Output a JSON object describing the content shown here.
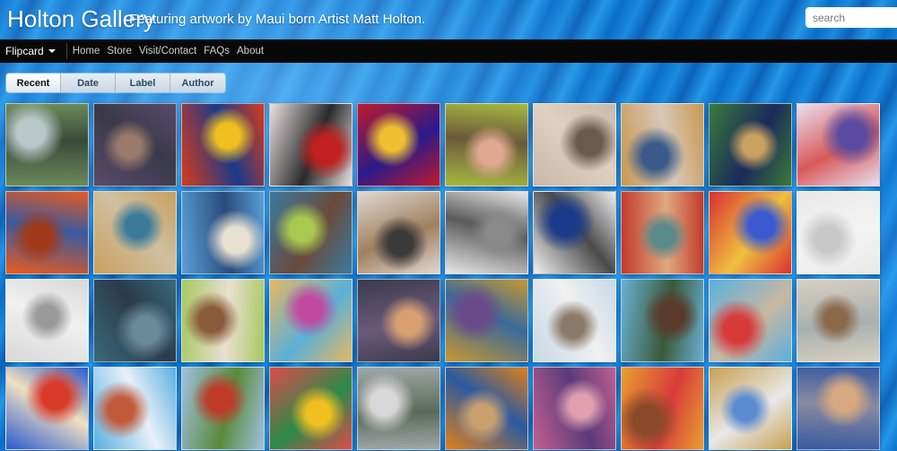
{
  "header": {
    "title": "Holton Gallery",
    "tagline": "Featuring artwork by Maui born Artist Matt Holton.",
    "search_placeholder": "search"
  },
  "navbar": {
    "brand": "Flipcard",
    "items": [
      "Home",
      "Store",
      "Visit/Contact",
      "FAQs",
      "About"
    ]
  },
  "sort_tabs": [
    "Recent",
    "Date",
    "Label",
    "Author"
  ],
  "active_tab": "Recent",
  "gallery": {
    "thumbnails": [
      {
        "name": "horses-river-painting",
        "colors": [
          "#6a8a5a",
          "#b8c8c8",
          "#3a4a3a"
        ]
      },
      {
        "name": "woman-guitar-painting",
        "colors": [
          "#5a4a6a",
          "#9a7a6a",
          "#3a3a4a"
        ]
      },
      {
        "name": "tiki-mask-painting",
        "colors": [
          "#d83a1a",
          "#f0c020",
          "#1a3a8a"
        ]
      },
      {
        "name": "red-stencil-art",
        "colors": [
          "#e8e0e0",
          "#c02020",
          "#2a2a2a"
        ]
      },
      {
        "name": "red-mandala-quilt",
        "colors": [
          "#c01a2a",
          "#f0c030",
          "#2a1a8a"
        ]
      },
      {
        "name": "reclining-figure-painting",
        "colors": [
          "#a8b840",
          "#e0a890",
          "#6a5a3a"
        ]
      },
      {
        "name": "woman-flower-hair",
        "colors": [
          "#c8b8a8",
          "#6a5a4a",
          "#e0d0c0"
        ]
      },
      {
        "name": "framed-athlete-portrait",
        "colors": [
          "#c89850",
          "#3a5a8a",
          "#d8c8b8"
        ]
      },
      {
        "name": "female-athlete-portrait",
        "colors": [
          "#3a7a3a",
          "#c8a060",
          "#1a2a5a"
        ]
      },
      {
        "name": "runner-blue-border",
        "colors": [
          "#e8e0f0",
          "#5a4aa0",
          "#d85a5a"
        ]
      },
      {
        "name": "abstract-bottle",
        "colors": [
          "#e85a20",
          "#a03a1a",
          "#3a5aa0"
        ]
      },
      {
        "name": "artist-with-painting",
        "colors": [
          "#c8a060",
          "#3a7a9a",
          "#d0c0a0"
        ]
      },
      {
        "name": "runner-blue-painting",
        "colors": [
          "#5aa0d8",
          "#e8e0d0",
          "#2a4a7a"
        ]
      },
      {
        "name": "face-headscarf-painting",
        "colors": [
          "#3a7aa0",
          "#a8c850",
          "#6a4a3a"
        ]
      },
      {
        "name": "gallery-visitor-photo",
        "colors": [
          "#e0d8d0",
          "#3a3a3a",
          "#a08060"
        ]
      },
      {
        "name": "gallery-crowd-photo",
        "colors": [
          "#e8e8e8",
          "#8a8a8a",
          "#5a5a5a"
        ]
      },
      {
        "name": "art-maui-sign",
        "colors": [
          "#f0f0f0",
          "#1a3a8a",
          "#4a4a4a"
        ]
      },
      {
        "name": "veiled-woman-portrait",
        "colors": [
          "#c03a2a",
          "#5a8a8a",
          "#e0a880"
        ]
      },
      {
        "name": "victory-runners-painting",
        "colors": [
          "#d83030",
          "#3a5ad0",
          "#f0c040"
        ]
      },
      {
        "name": "sketch-on-canvas",
        "colors": [
          "#e8e8e8",
          "#c8c8c8",
          "#f4f4f4"
        ]
      },
      {
        "name": "pencil-runner-sketch",
        "colors": [
          "#d8d8d8",
          "#9a9a9a",
          "#f0f0f0"
        ]
      },
      {
        "name": "banyan-tree-painting",
        "colors": [
          "#3a6a7a",
          "#6a8a9a",
          "#2a3a4a"
        ]
      },
      {
        "name": "girl-flower-crown",
        "colors": [
          "#a8c860",
          "#8a5a3a",
          "#e8e0d0"
        ]
      },
      {
        "name": "woman-floral-headdress",
        "colors": [
          "#e8b860",
          "#c04aa0",
          "#5ab0d8"
        ]
      },
      {
        "name": "dancers-painting",
        "colors": [
          "#3a3a4a",
          "#d8a070",
          "#6a5a7a"
        ]
      },
      {
        "name": "framed-figure-painting",
        "colors": [
          "#c89830",
          "#6a4a8a",
          "#3a6a9a"
        ]
      },
      {
        "name": "owl-painting",
        "colors": [
          "#c8d8e8",
          "#8a7a6a",
          "#f0f0f0"
        ]
      },
      {
        "name": "warrior-painting",
        "colors": [
          "#6ab0d0",
          "#5a3a2a",
          "#3a5a3a"
        ]
      },
      {
        "name": "runner-and-elder-portrait",
        "colors": [
          "#5ab0e0",
          "#d83a3a",
          "#c8b8a0"
        ]
      },
      {
        "name": "cyclist-sketch",
        "colors": [
          "#d8d0c0",
          "#8a6a4a",
          "#a8b0b0"
        ]
      },
      {
        "name": "surfer-wave-painting",
        "colors": [
          "#2a5ad0",
          "#d83a2a",
          "#f0e0c0"
        ]
      },
      {
        "name": "runner-blue-rays",
        "colors": [
          "#5ab0e0",
          "#c05a3a",
          "#e8f0f8"
        ]
      },
      {
        "name": "red-house-painting",
        "colors": [
          "#a0c0e0",
          "#c03a2a",
          "#5a8a3a"
        ]
      },
      {
        "name": "rainbow-arch-figure",
        "colors": [
          "#e04a4a",
          "#f0c020",
          "#2a8a4a"
        ]
      },
      {
        "name": "child-on-street-photo",
        "colors": [
          "#a0a8a8",
          "#d8d8d8",
          "#5a6a5a"
        ]
      },
      {
        "name": "bald-man-portrait",
        "colors": [
          "#e0801a",
          "#c8a070",
          "#2a5aa0"
        ]
      },
      {
        "name": "pink-abstract-figures",
        "colors": [
          "#c06090",
          "#e0a0b0",
          "#5a3a7a"
        ]
      },
      {
        "name": "woman-lei-portrait",
        "colors": [
          "#e8a030",
          "#8a4a2a",
          "#d83a3a"
        ]
      },
      {
        "name": "framed-church-painting",
        "colors": [
          "#c8a050",
          "#5a8ad0",
          "#e8e8e8"
        ]
      },
      {
        "name": "reaching-figure-painting",
        "colors": [
          "#3a5aa0",
          "#d8a880",
          "#8a8aa0"
        ]
      }
    ]
  }
}
